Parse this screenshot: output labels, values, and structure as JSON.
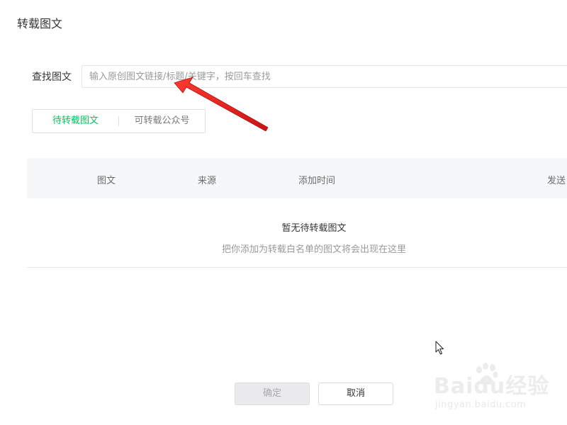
{
  "dialog": {
    "title": "转载图文"
  },
  "search": {
    "label": "查找图文",
    "placeholder": "输入原创图文链接/标题/关键字，按回车查找",
    "value": ""
  },
  "tabs": [
    {
      "label": "待转载图文",
      "active": true
    },
    {
      "label": "可转载公众号",
      "active": false
    }
  ],
  "table": {
    "columns": [
      "图文",
      "来源",
      "添加时间",
      "发送"
    ]
  },
  "empty_state": {
    "title": "暂无待转载图文",
    "description": "把你添加为转载白名单的图文将会出现在这里"
  },
  "footer": {
    "confirm_label": "确定",
    "cancel_label": "取消"
  },
  "watermark": {
    "logo": "Baidu经验",
    "url": "jingyan.baidu.com"
  },
  "colors": {
    "accent": "#07c160",
    "annotation_arrow": "#e02020"
  },
  "icons": {
    "cursor": "mouse-pointer-icon",
    "annotation": "red-arrow-icon"
  }
}
